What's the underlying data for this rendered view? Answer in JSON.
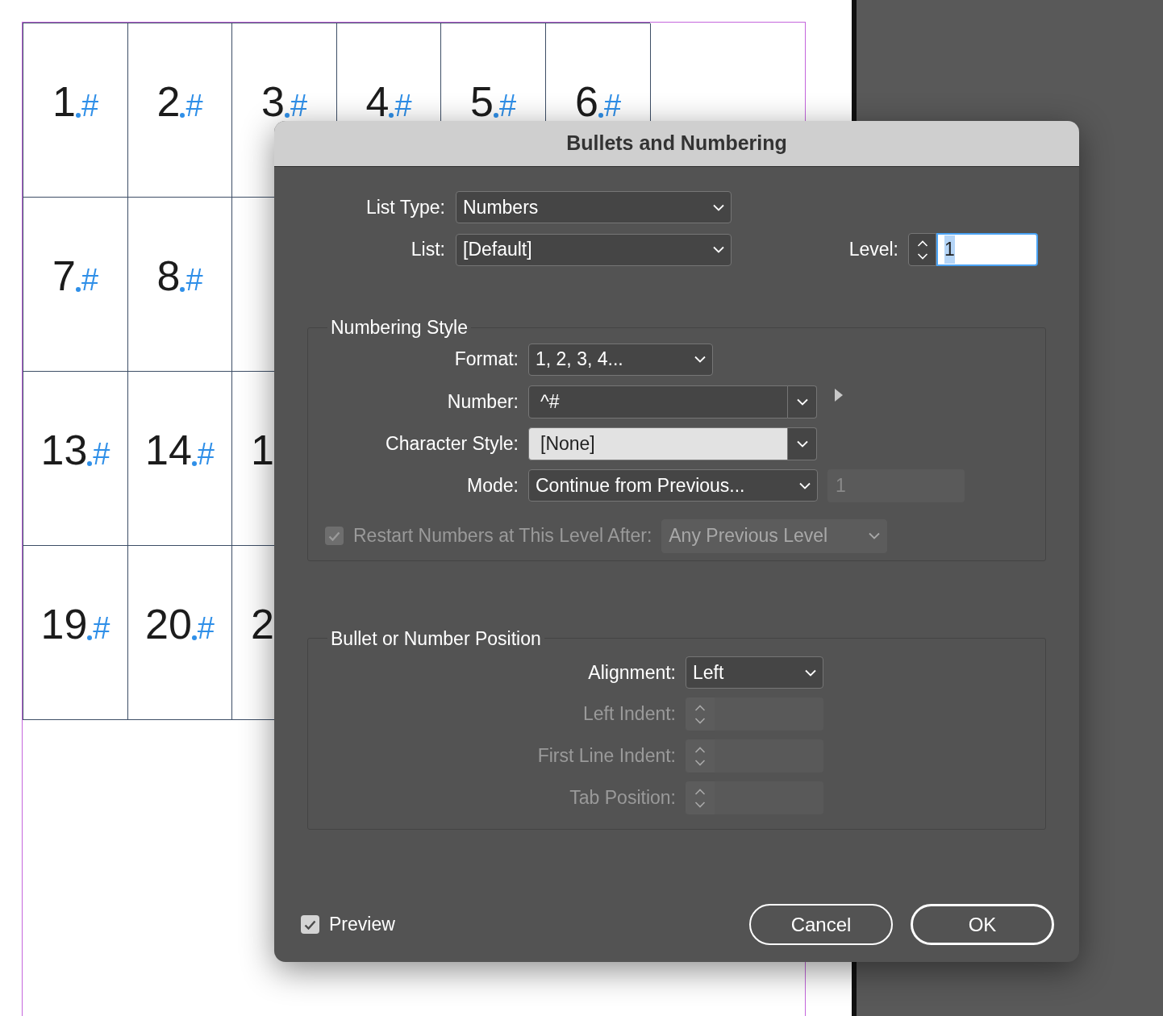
{
  "document": {
    "table": {
      "rows": [
        [
          {
            "number": "1",
            "marker": "#"
          },
          {
            "number": "2",
            "marker": "#"
          },
          {
            "number": "3",
            "marker": "#"
          },
          {
            "number": "4",
            "marker": "#"
          },
          {
            "number": "5",
            "marker": "#"
          },
          {
            "number": "6",
            "marker": "#"
          }
        ],
        [
          {
            "number": "7",
            "marker": "#"
          },
          {
            "number": "8",
            "marker": "#"
          }
        ],
        [
          {
            "number": "13",
            "marker": "#"
          },
          {
            "number": "14",
            "marker": "#"
          },
          {
            "number": "1",
            "clipped": true
          }
        ],
        [
          {
            "number": "19",
            "marker": "#"
          },
          {
            "number": "20",
            "marker": "#"
          },
          {
            "number": "2",
            "clipped": true
          }
        ]
      ]
    }
  },
  "dialog": {
    "title": "Bullets and Numbering",
    "list_type": {
      "label": "List Type:",
      "value": "Numbers"
    },
    "list": {
      "label": "List:",
      "value": "[Default]"
    },
    "level": {
      "label": "Level:",
      "value": "1"
    },
    "numbering_style": {
      "title": "Numbering Style",
      "format": {
        "label": "Format:",
        "value": "1, 2, 3, 4..."
      },
      "number": {
        "label": "Number:",
        "value": "^#"
      },
      "character_style": {
        "label": "Character Style:",
        "value": "[None]"
      },
      "mode": {
        "label": "Mode:",
        "value": "Continue from Previous...",
        "start_at": {
          "value": "1",
          "disabled": true
        }
      },
      "restart": {
        "label": "Restart Numbers at This Level After:",
        "checked": true,
        "disabled": true,
        "value": "Any Previous Level"
      }
    },
    "position": {
      "title": "Bullet or Number Position",
      "alignment": {
        "label": "Alignment:",
        "value": "Left"
      },
      "fields": [
        {
          "label": "Left Indent:",
          "disabled": true
        },
        {
          "label": "First Line Indent:",
          "disabled": true
        },
        {
          "label": "Tab Position:",
          "disabled": true
        }
      ]
    },
    "preview": {
      "label": "Preview",
      "checked": true
    },
    "buttons": [
      {
        "label": "Cancel",
        "kind": "secondary"
      },
      {
        "label": "OK",
        "kind": "default"
      }
    ]
  }
}
